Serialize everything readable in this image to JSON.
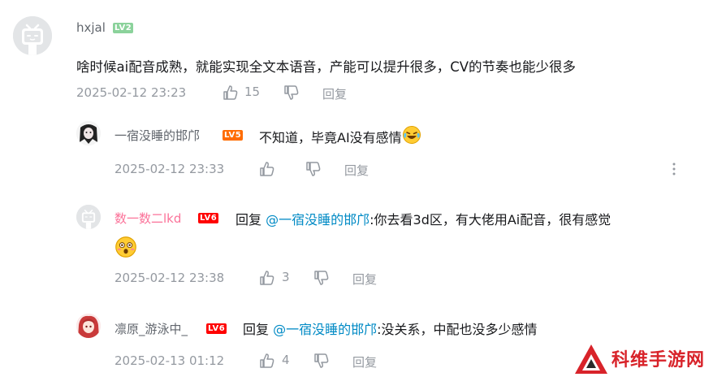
{
  "main_comment": {
    "username": "hxjal",
    "level": "LV2",
    "text": "啥时候ai配音成熟，就能实现全文本语音，产能可以提升很多，CV的节奏也能少很多",
    "time": "2025-02-12 23:23",
    "likes": "15",
    "reply_label": "回复"
  },
  "replies": [
    {
      "username": "一宿没睡的邯邝",
      "level": "LV5",
      "text": "不知道，毕竟AI没有感情",
      "time": "2025-02-12 23:33",
      "likes": "",
      "reply_label": "回复"
    },
    {
      "username": "数一数二lkd",
      "level": "LV6",
      "reply_prefix": "回复",
      "mention": "@一宿没睡的邯邝",
      "text": ":你去看3d区，有大佬用Ai配音，很有感觉",
      "time": "2025-02-12 23:38",
      "likes": "3",
      "reply_label": "回复"
    },
    {
      "username": "凛原_游泳中_",
      "level": "LV6",
      "reply_prefix": "回复",
      "mention": "@一宿没睡的邯邝",
      "text": ":没关系，中配也没多少感情",
      "time": "2025-02-13 01:12",
      "likes": "4",
      "reply_label": "回复"
    }
  ],
  "watermark": "科维手游网",
  "icons": [
    "like-icon",
    "dislike-icon",
    "more-icon",
    "tv-avatar-icon",
    "laugh-cry-emoji",
    "surprised-emoji"
  ],
  "colors": {
    "mention": "#008ac5",
    "meta": "#9499a0",
    "pink_name": "#fb7299",
    "lv2": "#8bd29b",
    "lv5": "#ff6c00",
    "lv6": "#ff0000",
    "watermark": "#d8232a"
  }
}
